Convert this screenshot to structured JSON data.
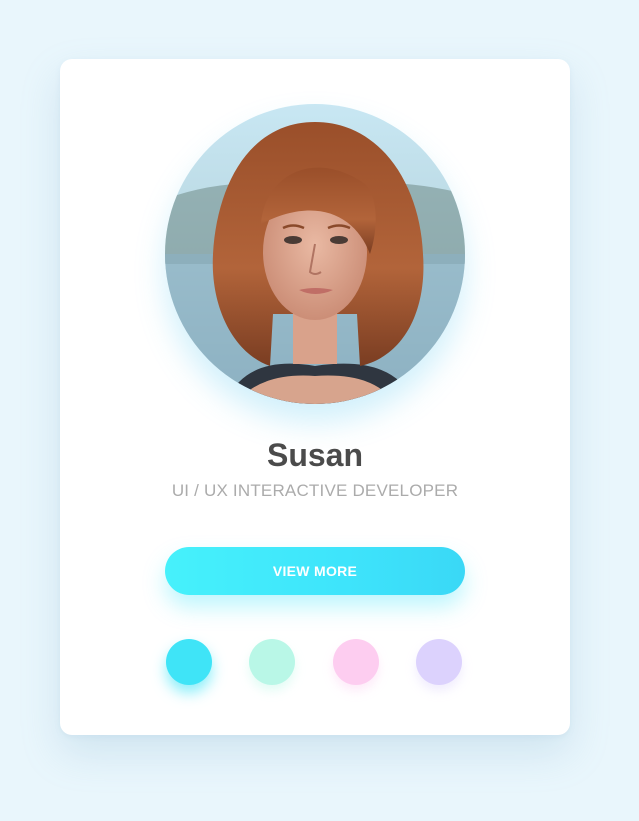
{
  "profile": {
    "name": "Susan",
    "role": "UI / UX INTERACTIVE DEVELOPER",
    "avatar_alt": "profile-photo"
  },
  "actions": {
    "view_more_label": "VIEW MORE"
  },
  "swatches": [
    {
      "name": "cyan",
      "color": "#3fe4f7",
      "selected": true
    },
    {
      "name": "mint",
      "color": "#b9f7e7",
      "selected": false
    },
    {
      "name": "pink",
      "color": "#fdcdf0",
      "selected": false
    },
    {
      "name": "lavender",
      "color": "#dcd2fd",
      "selected": false
    }
  ],
  "colors": {
    "background": "#e9f6fc",
    "card": "#ffffff",
    "accent": "#3fe4f7"
  }
}
